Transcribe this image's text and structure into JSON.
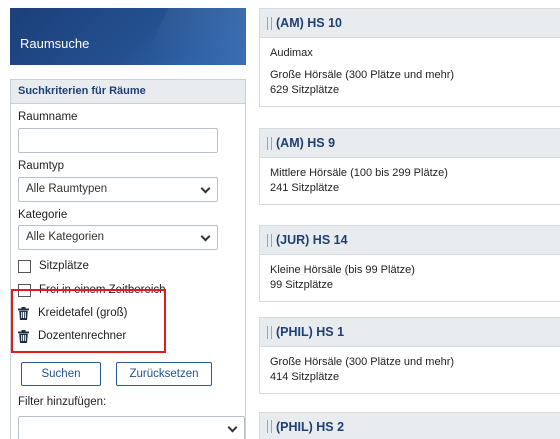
{
  "sidebar": {
    "title": "Raumsuche",
    "criteria_title": "Suchkriterien für Räume",
    "raumname_label": "Raumname",
    "raumname_value": "",
    "raumtyp_label": "Raumtyp",
    "raumtyp_value": "Alle Raumtypen",
    "kategorie_label": "Kategorie",
    "kategorie_value": "Alle Kategorien",
    "checkboxes": [
      {
        "label": "Sitzplätze",
        "checked": false
      },
      {
        "label": "Frei in einem Zeitbereich",
        "checked": false
      }
    ],
    "active_filters": [
      {
        "label": "Kreidetafel (groß)",
        "icon": "trash-icon"
      },
      {
        "label": "Dozentenrechner",
        "icon": "trash-icon"
      }
    ],
    "search_button": "Suchen",
    "reset_button": "Zurücksetzen",
    "add_filter_label": "Filter hinzufügen:",
    "add_filter_value": ""
  },
  "results": [
    {
      "title": "(AM) HS 10",
      "subtitle": "Audimax",
      "category": "Große Hörsäle (300 Plätze und mehr)",
      "seats": "629 Sitzplätze"
    },
    {
      "title": "(AM) HS 9",
      "category": "Mittlere Hörsäle (100 bis 299 Plätze)",
      "seats": "241 Sitzplätze"
    },
    {
      "title": "(JUR) HS 14",
      "category": "Kleine Hörsäle (bis 99 Plätze)",
      "seats": "99 Sitzplätze"
    },
    {
      "title": "(PHIL) HS 1",
      "category": "Große Hörsäle (300 Plätze und mehr)",
      "seats": "414 Sitzplätze"
    },
    {
      "title": "(PHIL) HS 2"
    }
  ],
  "colors": {
    "header": "#24508f",
    "highlight": "#e01c1c",
    "accent": "#1f3f73"
  }
}
